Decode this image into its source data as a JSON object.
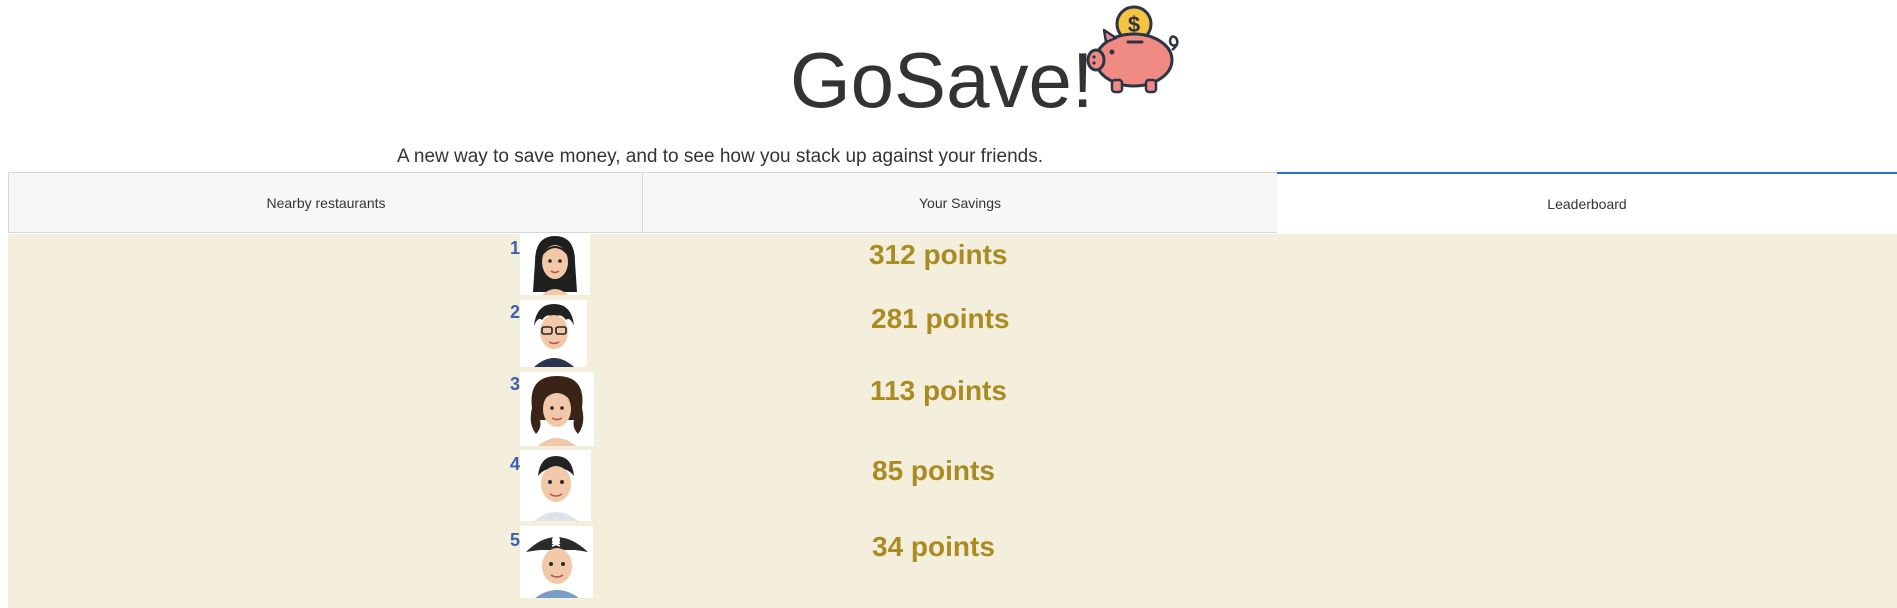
{
  "header": {
    "title": "GoSave!",
    "tagline": "A new way to save money, and to see how you stack up against your friends.",
    "logo_icon": "piggy-bank-dollar-icon"
  },
  "tabs": [
    {
      "label": "Nearby restaurants",
      "active": false
    },
    {
      "label": "Your Savings",
      "active": false
    },
    {
      "label": "Leaderboard",
      "active": true
    }
  ],
  "leaderboard": [
    {
      "rank": "1",
      "points": "312 points",
      "avatar": "avatar-woman-long-dark-hair"
    },
    {
      "rank": "2",
      "points": "281 points",
      "avatar": "avatar-man-glasses"
    },
    {
      "rank": "3",
      "points": "113 points",
      "avatar": "avatar-woman-curly-hair"
    },
    {
      "rank": "4",
      "points": "85 points",
      "avatar": "avatar-man-short-hair"
    },
    {
      "rank": "5",
      "points": "34 points",
      "avatar": "avatar-man-pirate-hat"
    }
  ],
  "colors": {
    "accent": "#2a6fd6",
    "board_bg": "#f3efdc",
    "points": "#a98b22",
    "rank": "#3a5fb5"
  }
}
